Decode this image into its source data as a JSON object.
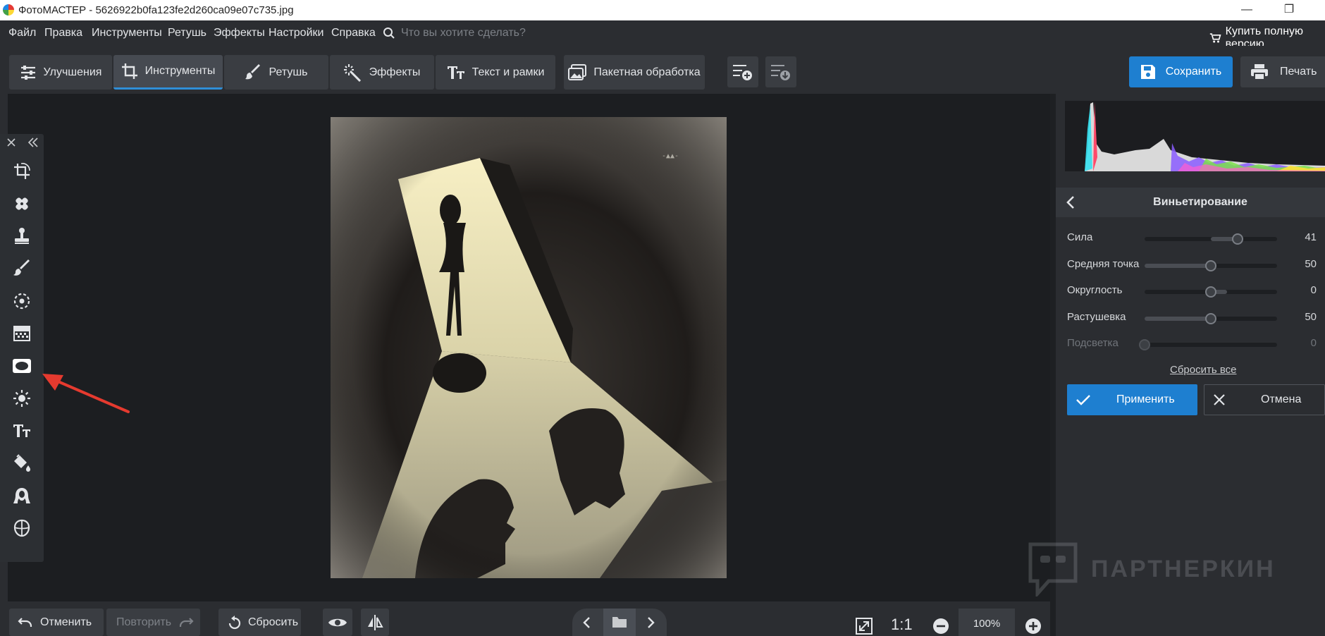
{
  "window": {
    "title": "ФотоМАСТЕР - 5626922b0fa123fe2d260ca09e07c735.jpg",
    "minimize_glyph": "—",
    "restore_glyph": "❐"
  },
  "menu": {
    "items": [
      "Файл",
      "Правка",
      "Инструменты",
      "Ретушь",
      "Эффекты",
      "Настройки",
      "Справка"
    ],
    "search_placeholder": "Что вы хотите сделать?",
    "buy_label": "Купить полную версию"
  },
  "toolbar": {
    "tabs": [
      {
        "label": "Улучшения",
        "icon": "sliders-icon"
      },
      {
        "label": "Инструменты",
        "icon": "crop-icon",
        "active": true
      },
      {
        "label": "Ретушь",
        "icon": "brush-icon"
      },
      {
        "label": "Эффекты",
        "icon": "magic-wand-icon"
      },
      {
        "label": "Текст и рамки",
        "icon": "text-icon"
      }
    ],
    "batch_label": "Пакетная обработка",
    "save_label": "Сохранить",
    "print_label": "Печать"
  },
  "tool_strip": {
    "tools": [
      "crop-tool-icon",
      "healing-patch-icon",
      "clone-stamp-icon",
      "brush-icon",
      "radial-filter-icon",
      "gradient-filter-icon",
      "vignette-icon",
      "light-icon",
      "text-icon",
      "fill-bucket-icon",
      "portrait-icon",
      "face-contour-icon"
    ],
    "selected": "vignette-icon"
  },
  "vignette_panel": {
    "title": "Виньетирование",
    "sliders": [
      {
        "label": "Сила",
        "value": "41",
        "percent": 70,
        "center_fill": true
      },
      {
        "label": "Средняя точка",
        "value": "50",
        "percent": 50
      },
      {
        "label": "Округлость",
        "value": "0",
        "percent": 50,
        "center_fill": true
      },
      {
        "label": "Растушевка",
        "value": "50",
        "percent": 50
      },
      {
        "label": "Подсветка",
        "value": "0",
        "percent": 0,
        "disabled": true
      }
    ],
    "reset_all_label": "Сбросить все",
    "apply_label": "Применить",
    "cancel_label": "Отмена"
  },
  "bottom_bar": {
    "undo_label": "Отменить",
    "redo_label": "Повторить",
    "reset_label": "Сбросить",
    "fit_label": "1:1",
    "zoom_value": "100%"
  },
  "watermark": "ПАРТНЕРКИН",
  "colors": {
    "accent": "#1e7fd0",
    "background": "#1e2023",
    "panel": "#2b2d31",
    "arrow": "#e53a2f"
  }
}
